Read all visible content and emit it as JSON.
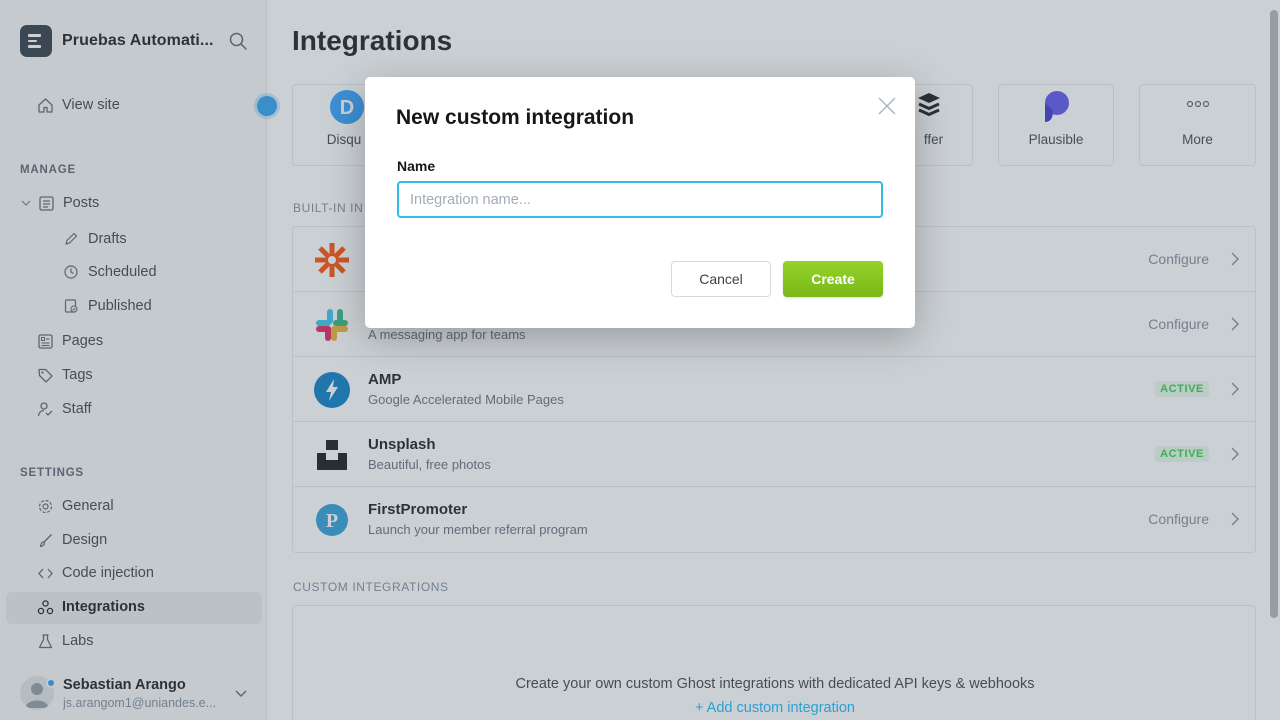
{
  "sidebar": {
    "site_name": "Pruebas Automati...",
    "view_site": "View site",
    "manage_label": "MANAGE",
    "items": [
      {
        "label": "Posts"
      },
      {
        "label": "Drafts"
      },
      {
        "label": "Scheduled"
      },
      {
        "label": "Published"
      },
      {
        "label": "Pages"
      },
      {
        "label": "Tags"
      },
      {
        "label": "Staff"
      }
    ],
    "settings_label": "SETTINGS",
    "settings_items": [
      {
        "label": "General"
      },
      {
        "label": "Design"
      },
      {
        "label": "Code injection"
      },
      {
        "label": "Integrations"
      },
      {
        "label": "Labs"
      }
    ],
    "user": {
      "name": "Sebastian Arango",
      "email": "js.arangom1@uniandes.e..."
    }
  },
  "main": {
    "title": "Integrations",
    "tiles": [
      {
        "label": "Disqus",
        "visible_label": "Disqu"
      },
      {
        "label": "Buffer",
        "visible_label": "ffer"
      },
      {
        "label": "Plausible"
      },
      {
        "label": "More"
      }
    ],
    "builtin_label": "BUILT-IN IN",
    "builtin": [
      {
        "title": "",
        "desc": "",
        "action": "Configure"
      },
      {
        "title": "",
        "desc": "A messaging app for teams",
        "action": "Configure"
      },
      {
        "title": "AMP",
        "desc": "Google Accelerated Mobile Pages",
        "badge": "ACTIVE"
      },
      {
        "title": "Unsplash",
        "desc": "Beautiful, free photos",
        "badge": "ACTIVE"
      },
      {
        "title": "FirstPromoter",
        "desc": "Launch your member referral program",
        "action": "Configure"
      }
    ],
    "custom_label": "CUSTOM INTEGRATIONS",
    "custom_text": "Create your own custom Ghost integrations with dedicated API keys & webhooks",
    "custom_link": "+ Add custom integration"
  },
  "modal": {
    "title": "New custom integration",
    "name_label": "Name",
    "input_value": "",
    "input_placeholder": "Integration name...",
    "cancel_label": "Cancel",
    "create_label": "Create"
  },
  "colors": {
    "accent_green": "#7ab819",
    "focus_blue": "#30bee6",
    "link_blue": "#14b8ff",
    "active_badge": "#30cf43"
  }
}
